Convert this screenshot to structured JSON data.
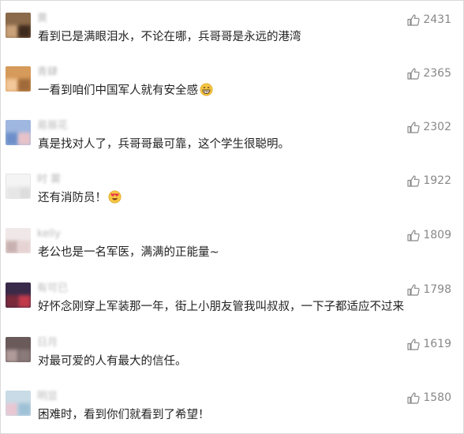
{
  "comments": [
    {
      "username": "黄",
      "text": "看到已是满眼泪水，不论在哪，兵哥哥是永远的港湾",
      "emoji": "",
      "likes": "2431",
      "avatar_colors": [
        "#8a6a4a",
        "#c9a27a",
        "#3f2b1e"
      ]
    },
    {
      "username": "青肆",
      "text": "一看到咱们中国军人就有安全感",
      "emoji": "grin-emoji",
      "likes": "2365",
      "avatar_colors": [
        "#d69a5a",
        "#f3c89a",
        "#a06a3a"
      ]
    },
    {
      "username": "易振花",
      "text": "真是找对人了，兵哥哥最可靠，这个学生很聪明。",
      "emoji": "",
      "likes": "2302",
      "avatar_colors": [
        "#9fb7e0",
        "#6d8fc9",
        "#e8c2c8"
      ]
    },
    {
      "username": "时 雾",
      "text": "还有消防员！",
      "emoji": "heart-eyes-emoji",
      "likes": "1922",
      "avatar_colors": [
        "#f4f4f4",
        "#e6e6e6",
        "#dddddd"
      ]
    },
    {
      "username": "kelly",
      "text": "老公也是一名军医，满满的正能量~",
      "emoji": "",
      "likes": "1809",
      "avatar_colors": [
        "#f0e8e8",
        "#c9b0b0",
        "#e6d2d2"
      ]
    },
    {
      "username": "有可已",
      "text": "好怀念刚穿上军装那一年，街上小朋友管我叫叔叔，一下子都适应不过来",
      "emoji": "",
      "likes": "1798",
      "avatar_colors": [
        "#3a2a4a",
        "#7a2a3a",
        "#c23a4a"
      ]
    },
    {
      "username": "日月",
      "text": "对最可爱的人有最大的信任。",
      "emoji": "",
      "likes": "1619",
      "avatar_colors": [
        "#6a5a5a",
        "#b09a9a",
        "#8a7a7a"
      ]
    },
    {
      "username": "明显",
      "text": "困难时，看到你们就看到了希望！",
      "emoji": "",
      "likes": "1580",
      "avatar_colors": [
        "#c8dbe6",
        "#e9c7d2",
        "#9fc1d6"
      ]
    }
  ]
}
